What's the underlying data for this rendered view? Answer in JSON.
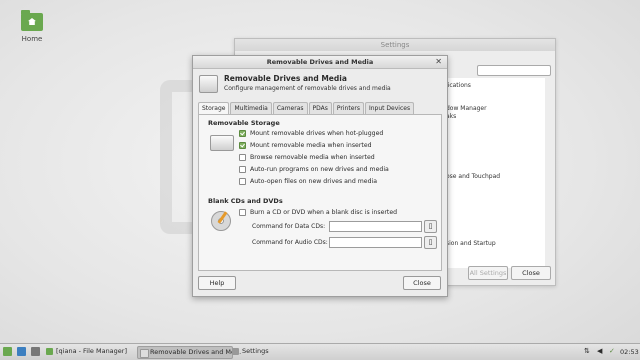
{
  "desktop": {
    "home_label": "Home"
  },
  "settings_window": {
    "title": "Settings",
    "snippets": [
      "lications",
      "dow Manager",
      "aks",
      "ose and Touchpad",
      "sion and Startup"
    ],
    "all_settings": "All Settings",
    "close": "Close"
  },
  "dialog": {
    "title": "Removable Drives and Media",
    "header_title": "Removable Drives and Media",
    "header_subtitle": "Configure management of removable drives and media",
    "tabs": [
      "Storage",
      "Multimedia",
      "Cameras",
      "PDAs",
      "Printers",
      "Input Devices"
    ],
    "storage": {
      "section_removable": "Removable Storage",
      "options": [
        {
          "label": "Mount removable drives when hot-plugged",
          "checked": true
        },
        {
          "label": "Mount removable media when inserted",
          "checked": true
        },
        {
          "label": "Browse removable media when inserted",
          "checked": false
        },
        {
          "label": "Auto-run programs on new drives and media",
          "checked": false
        },
        {
          "label": "Auto-open files on new drives and media",
          "checked": false
        }
      ],
      "section_blank": "Blank CDs and DVDs",
      "burn_option": {
        "label": "Burn a CD or DVD when a blank disc is inserted",
        "checked": false
      },
      "data_cds_label": "Command for Data CDs:",
      "audio_cds_label": "Command for Audio CDs:",
      "data_cds_value": "",
      "audio_cds_value": ""
    },
    "help_button": "Help",
    "close_button": "Close"
  },
  "taskbar": {
    "items": [
      "[qiana - File Manager]",
      "Removable Drives and Me...",
      "Settings"
    ],
    "clock": "02:53"
  }
}
